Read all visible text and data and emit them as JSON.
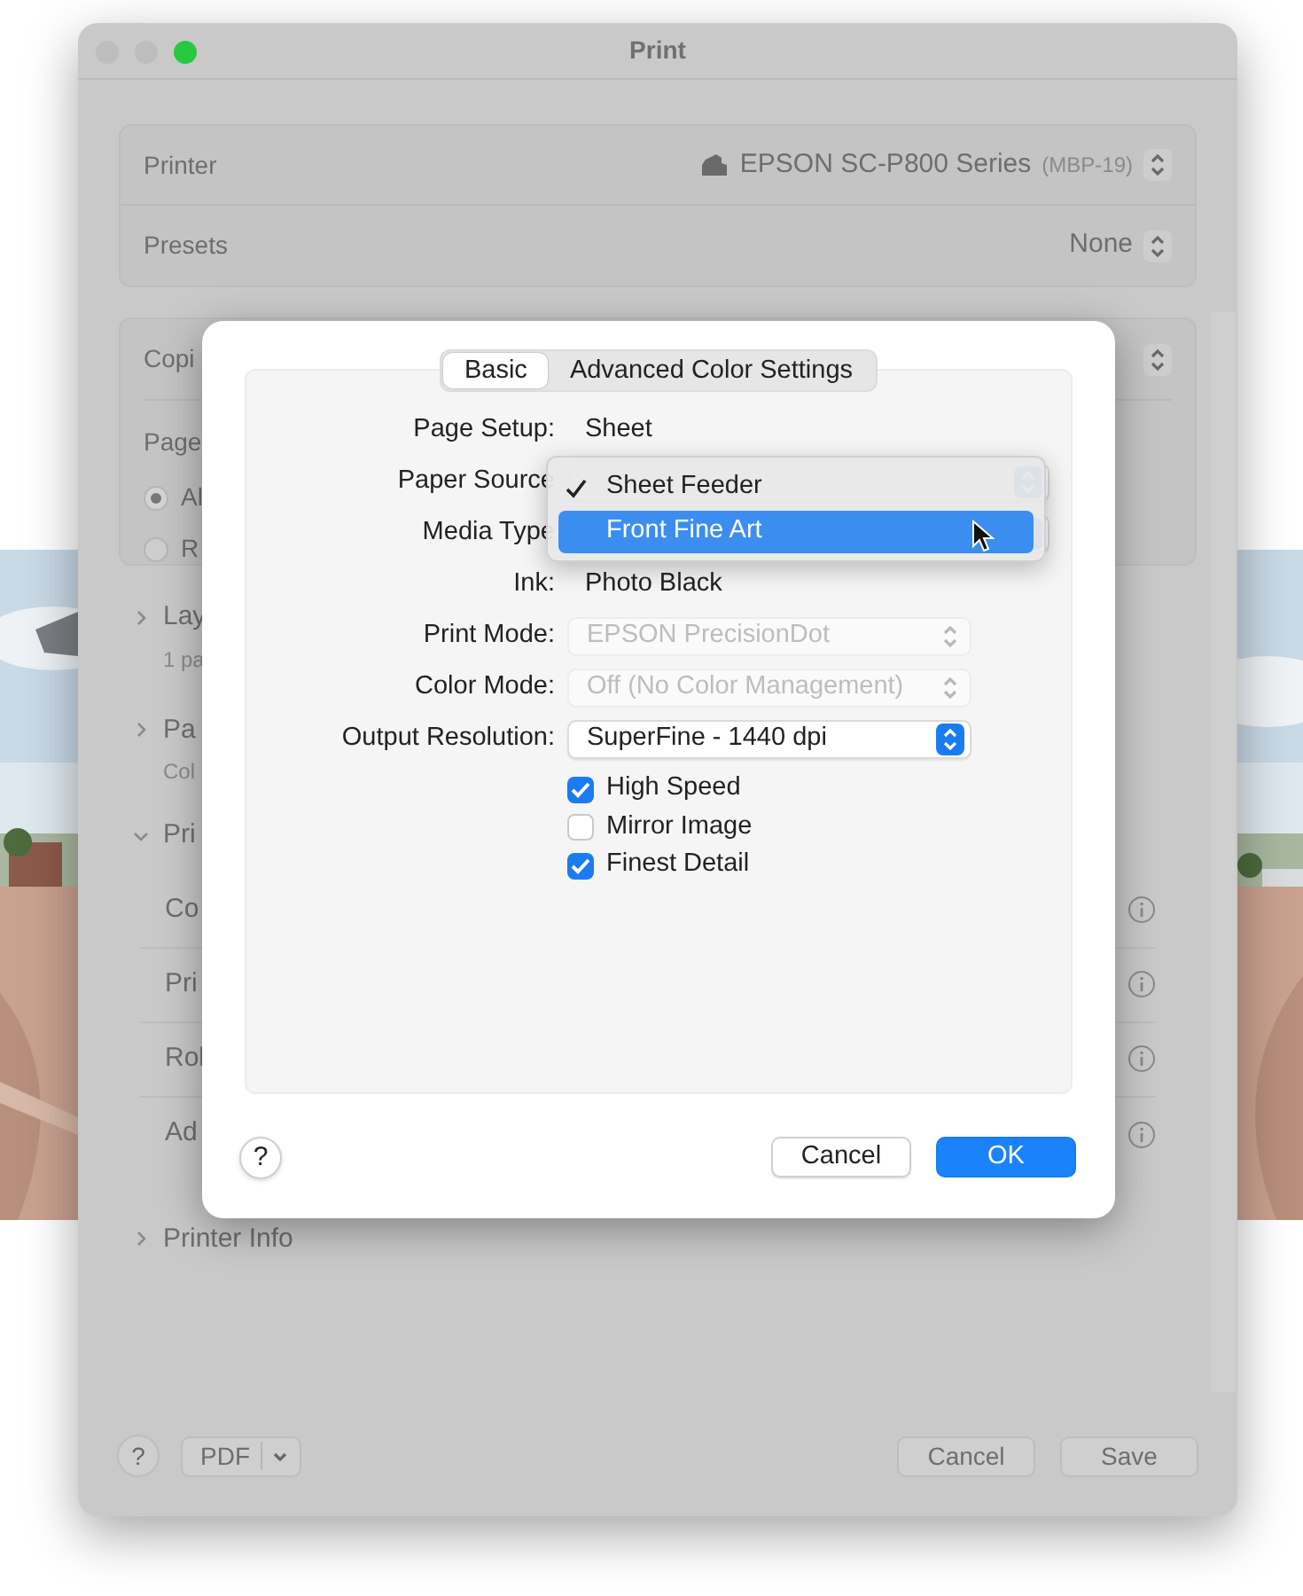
{
  "window": {
    "title": "Print",
    "controls": [
      {
        "kind": "close",
        "enabled": false
      },
      {
        "kind": "minimize",
        "enabled": false
      },
      {
        "kind": "zoom",
        "enabled": true
      }
    ]
  },
  "printer": {
    "label": "Printer",
    "value": "EPSON SC-P800 Series",
    "detail": "(MBP-19)"
  },
  "presets": {
    "label": "Presets",
    "value": "None"
  },
  "copies": {
    "label": "Copi"
  },
  "pages": {
    "label": "Page",
    "options": [
      {
        "label": "Al",
        "selected": true
      },
      {
        "label": "R",
        "selected": false
      }
    ]
  },
  "sections": [
    {
      "title": "Lay",
      "subtitle": "1 pa",
      "expanded": false
    },
    {
      "title": "Pa",
      "subtitle": "Col",
      "expanded": false
    },
    {
      "title": "Pri",
      "expanded": true,
      "children": [
        {
          "label": "Co"
        },
        {
          "label": "Pri"
        },
        {
          "label": "Rol"
        },
        {
          "label": "Ad"
        }
      ]
    },
    {
      "title": "Printer Info",
      "expanded": false
    }
  ],
  "footer": {
    "help": "?",
    "pdf": "PDF",
    "buttons": [
      "Cancel",
      "Save"
    ]
  },
  "sheet": {
    "tabs": [
      {
        "label": "Basic",
        "selected": true
      },
      {
        "label": "Advanced Color Settings",
        "selected": false
      }
    ],
    "fields": [
      {
        "kind": "text",
        "label": "Page Setup:",
        "value": "Sheet"
      },
      {
        "kind": "popup",
        "label": "Paper Source"
      },
      {
        "kind": "popup",
        "label": "Media Type"
      },
      {
        "kind": "text",
        "label": "Ink:",
        "value": "Photo Black"
      },
      {
        "kind": "popup",
        "label": "Print Mode:",
        "value": "EPSON PrecisionDot",
        "disabled": true
      },
      {
        "kind": "popup",
        "label": "Color Mode:",
        "value": "Off (No Color Management)",
        "disabled": true
      },
      {
        "kind": "popup",
        "label": "Output Resolution:",
        "value": "SuperFine - 1440 dpi",
        "disabled": false
      }
    ],
    "checkboxes": [
      {
        "label": "High Speed",
        "checked": true
      },
      {
        "label": "Mirror Image",
        "checked": false
      },
      {
        "label": "Finest Detail",
        "checked": true
      }
    ],
    "help": "?",
    "buttons": [
      {
        "label": "Cancel",
        "kind": "secondary"
      },
      {
        "label": "OK",
        "kind": "default"
      }
    ]
  },
  "menu": {
    "items": [
      {
        "label": "Sheet Feeder",
        "checked": true,
        "selected": false
      },
      {
        "label": "Front Fine Art",
        "checked": false,
        "selected": true
      }
    ]
  }
}
